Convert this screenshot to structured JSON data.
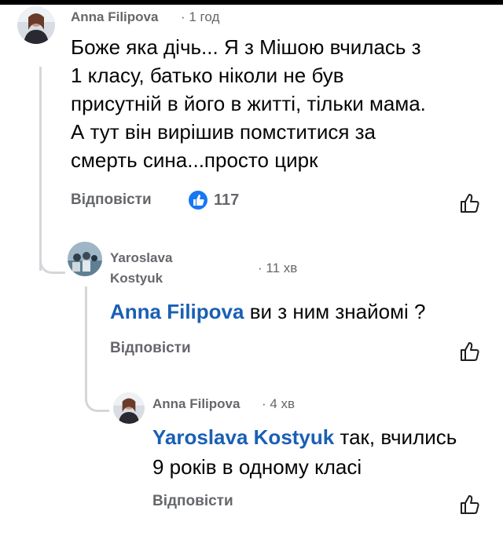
{
  "comments": [
    {
      "author": "Anna Filipova",
      "time": "· 1 год",
      "line1": "Боже яка дічь... Я з Мішою вчилась з",
      "line2": "1 класу, батько ніколи не був",
      "line3": "присутній в його в житті, тільки мама.",
      "line4": "А тут він вирішив помститися за",
      "line5": "смерть сина...просто цирк",
      "reply_label": "Відповісти",
      "reactions_count": "117"
    },
    {
      "author_line1": "Yaroslava",
      "author_line2": "Kostyuk",
      "time": "· 11 хв",
      "mention": "Anna Filipova",
      "text": " ви з ним знайомі ?",
      "reply_label": "Відповісти"
    },
    {
      "author": "Anna Filipova",
      "time": "· 4 хв",
      "mention": "Yaroslava Kostyuk",
      "text": " так, вчились",
      "line2": "9 років в одному класі",
      "reply_label": "Відповісти"
    }
  ],
  "colors": {
    "mention": "#1a5fb4",
    "like_badge": "#1877f2",
    "muted": "#65676b"
  }
}
